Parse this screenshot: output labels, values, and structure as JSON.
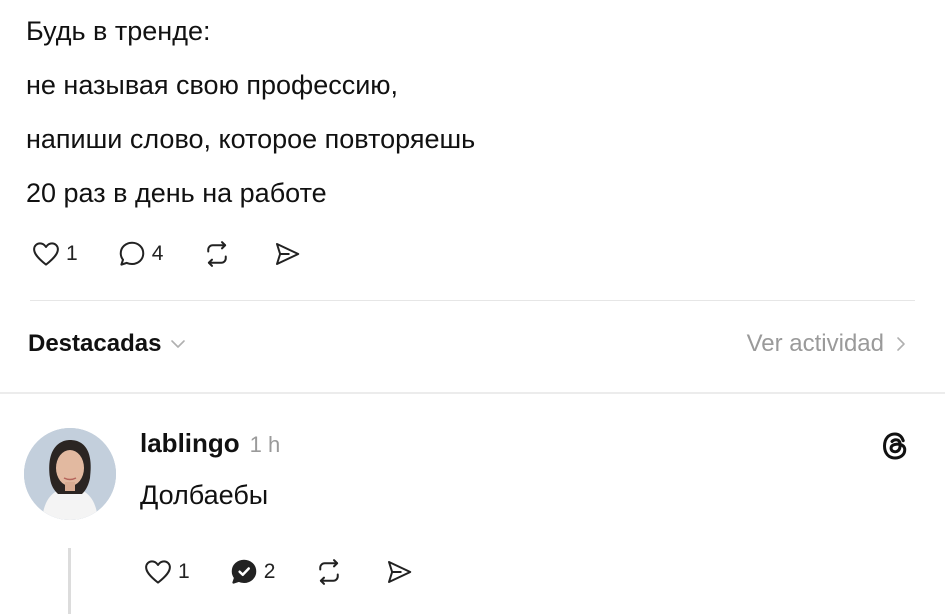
{
  "post": {
    "lines": [
      "Будь в тренде:",
      "не называя свою профессию,",
      "напиши слово, которое повторяешь",
      "20 раз в день на работе"
    ],
    "actions": {
      "like_icon": "heart-icon",
      "like_count": "1",
      "comment_icon": "comment-icon",
      "comment_count": "4",
      "repost_icon": "repost-icon",
      "share_icon": "share-icon"
    }
  },
  "replies_section": {
    "sort_label": "Destacadas",
    "sort_icon": "chevron-down-icon",
    "activity_label": "Ver actividad",
    "activity_icon": "chevron-right-icon"
  },
  "reply": {
    "username": "lablingo",
    "time": "1 h",
    "text": "Долбаебы",
    "platform_icon": "threads-logo-icon",
    "actions": {
      "like_count": "1",
      "comment_count": "2"
    }
  },
  "colors": {
    "text": "#111111",
    "muted": "#9a9a9a",
    "divider": "#e6e6e6"
  }
}
